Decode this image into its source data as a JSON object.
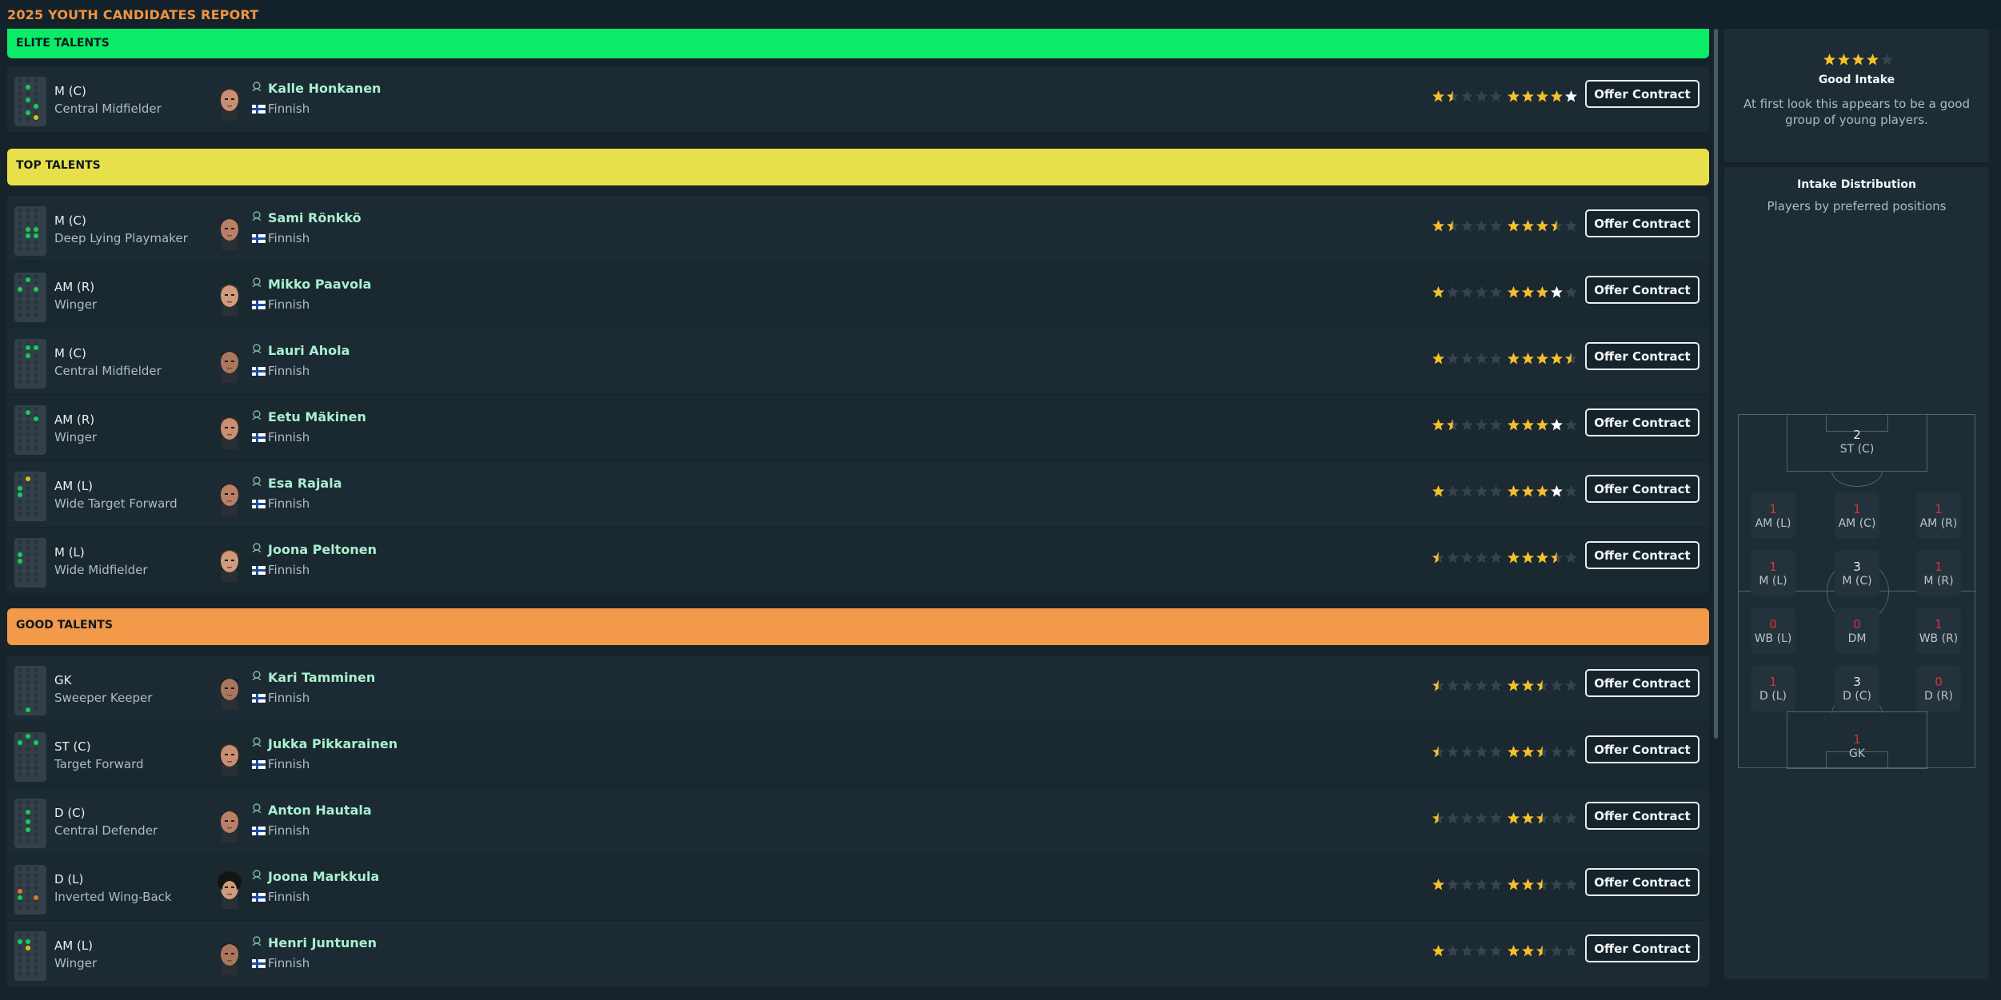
{
  "header": {
    "title": "2025 YOUTH CANDIDATES REPORT"
  },
  "colors": {
    "elite": "#0aeb68",
    "top": "#e8e04a",
    "good": "#f2994a",
    "star_gold": "#f5c02a",
    "name_green": "#a9f0cf"
  },
  "sections": {
    "elite": {
      "title": "ELITE TALENTS",
      "players": [
        {
          "position": "M (C)",
          "role": "Central Midfielder",
          "name": "Kalle Honkanen",
          "nationality": "Finnish",
          "current_ability_stars": 1.5,
          "potential_ability_stars": 5,
          "offer_label": "Offer Contract",
          "face": "face-icon",
          "dots": [
            [
              "g",
              14,
              10
            ],
            [
              "g",
              14,
              26
            ],
            [
              "g",
              24,
              34
            ],
            [
              "g",
              14,
              42
            ],
            [
              "y",
              24,
              48
            ]
          ]
        }
      ]
    },
    "top": {
      "title": "TOP TALENTS",
      "players": [
        {
          "position": "M (C)",
          "role": "Deep Lying Playmaker",
          "name": "Sami Rönkkö",
          "nationality": "Finnish",
          "current_ability_stars": 1.5,
          "potential_ability_stars": 3.5,
          "offer_label": "Offer Contract",
          "dots": [
            [
              "g",
              14,
              26
            ],
            [
              "g",
              24,
              26
            ],
            [
              "g",
              14,
              34
            ],
            [
              "g",
              24,
              34
            ]
          ]
        },
        {
          "position": "AM (R)",
          "role": "Winger",
          "name": "Mikko Paavola",
          "nationality": "Finnish",
          "current_ability_stars": 1,
          "potential_ability_stars": 4,
          "offer_label": "Offer Contract",
          "dots": [
            [
              "g",
              14,
              6
            ],
            [
              "g",
              4,
              18
            ],
            [
              "g",
              24,
              18
            ]
          ]
        },
        {
          "position": "M (C)",
          "role": "Central Midfielder",
          "name": "Lauri Ahola",
          "nationality": "Finnish",
          "current_ability_stars": 1,
          "potential_ability_stars": 4.5,
          "offer_label": "Offer Contract",
          "dots": [
            [
              "g",
              14,
              8
            ],
            [
              "g",
              24,
              8
            ],
            [
              "g",
              14,
              18
            ]
          ]
        },
        {
          "position": "AM (R)",
          "role": "Winger",
          "name": "Eetu Mäkinen",
          "nationality": "Finnish",
          "current_ability_stars": 1.5,
          "potential_ability_stars": 4,
          "offer_label": "Offer Contract",
          "dots": [
            [
              "g",
              14,
              6
            ],
            [
              "g",
              24,
              14
            ]
          ]
        },
        {
          "position": "AM (L)",
          "role": "Wide Target Forward",
          "name": "Esa Rajala",
          "nationality": "Finnish",
          "current_ability_stars": 1,
          "potential_ability_stars": 4,
          "offer_label": "Offer Contract",
          "dots": [
            [
              "y",
              14,
              6
            ],
            [
              "g",
              4,
              18
            ],
            [
              "g",
              4,
              26
            ]
          ]
        },
        {
          "position": "M (L)",
          "role": "Wide Midfielder",
          "name": "Joona Peltonen",
          "nationality": "Finnish",
          "current_ability_stars": 0.5,
          "potential_ability_stars": 3.5,
          "offer_label": "Offer Contract",
          "dots": [
            [
              "g",
              4,
              18
            ],
            [
              "g",
              4,
              26
            ]
          ]
        }
      ]
    },
    "good": {
      "title": "GOOD TALENTS",
      "players": [
        {
          "position": "GK",
          "role": "Sweeper Keeper",
          "name": "Kari Tamminen",
          "nationality": "Finnish",
          "current_ability_stars": 0.5,
          "potential_ability_stars": 2.5,
          "offer_label": "Offer Contract",
          "dots": [
            [
              "g",
              14,
              52
            ]
          ]
        },
        {
          "position": "ST (C)",
          "role": "Target Forward",
          "name": "Jukka Pikkarainen",
          "nationality": "Finnish",
          "current_ability_stars": 0.5,
          "potential_ability_stars": 2.5,
          "offer_label": "Offer Contract",
          "dots": [
            [
              "g",
              14,
              2
            ],
            [
              "g",
              4,
              10
            ],
            [
              "g",
              24,
              10
            ]
          ]
        },
        {
          "position": "D (C)",
          "role": "Central Defender",
          "name": "Anton Hautala",
          "nationality": "Finnish",
          "current_ability_stars": 0.5,
          "potential_ability_stars": 2.5,
          "offer_label": "Offer Contract",
          "dots": [
            [
              "g",
              14,
              14
            ],
            [
              "g",
              14,
              26
            ],
            [
              "g",
              14,
              36
            ]
          ]
        },
        {
          "position": "D (L)",
          "role": "Inverted Wing-Back",
          "name": "Joona Markkula",
          "nationality": "Finnish",
          "current_ability_stars": 1,
          "potential_ability_stars": 2.5,
          "offer_label": "Offer Contract",
          "dots": [
            [
              "o",
              4,
              30
            ],
            [
              "g",
              4,
              38
            ],
            [
              "o",
              24,
              38
            ]
          ]
        },
        {
          "position": "AM (L)",
          "role": "Winger",
          "name": "Henri Juntunen",
          "nationality": "Finnish",
          "current_ability_stars": 1,
          "potential_ability_stars": 2.5,
          "offer_label": "Offer Contract",
          "dots": [
            [
              "g",
              4,
              10
            ],
            [
              "g",
              14,
              10
            ],
            [
              "y",
              14,
              18
            ]
          ]
        }
      ]
    }
  },
  "sidebar": {
    "intake_rating_stars": 4,
    "intake_title": "Good Intake",
    "intake_description": "At first look this appears to be a good group of young players.",
    "distribution_title": "Intake Distribution",
    "distribution_subtitle": "Players by preferred positions",
    "positions": [
      {
        "label": "ST (C)",
        "count": "2",
        "color": "white"
      },
      {
        "label": "AM (L)",
        "count": "1",
        "color": "red"
      },
      {
        "label": "AM (C)",
        "count": "1",
        "color": "red"
      },
      {
        "label": "AM (R)",
        "count": "1",
        "color": "red"
      },
      {
        "label": "M (L)",
        "count": "1",
        "color": "red"
      },
      {
        "label": "M (C)",
        "count": "3",
        "color": "white"
      },
      {
        "label": "M (R)",
        "count": "1",
        "color": "red"
      },
      {
        "label": "WB (L)",
        "count": "0",
        "color": "red"
      },
      {
        "label": "DM",
        "count": "0",
        "color": "red"
      },
      {
        "label": "WB (R)",
        "count": "1",
        "color": "red"
      },
      {
        "label": "D (L)",
        "count": "1",
        "color": "red"
      },
      {
        "label": "D (C)",
        "count": "3",
        "color": "white"
      },
      {
        "label": "D (R)",
        "count": "0",
        "color": "red"
      },
      {
        "label": "GK",
        "count": "1",
        "color": "red"
      }
    ]
  }
}
